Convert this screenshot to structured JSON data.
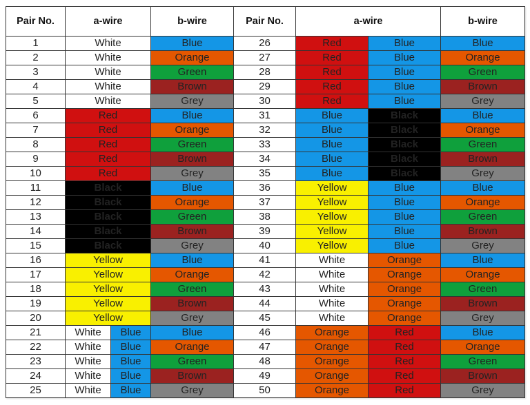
{
  "headers": {
    "pair_no": "Pair No.",
    "a_wire": "a-wire",
    "b_wire": "b-wire"
  },
  "colors": {
    "White": "#ffffff",
    "Blue": "#1496e6",
    "Orange": "#e55700",
    "Green": "#0fa03c",
    "Brown": "#9b2220",
    "Grey": "#828282",
    "Red": "#d01010",
    "Black": "#000000",
    "Yellow": "#f9f000"
  },
  "pairs": [
    {
      "pair": "1",
      "a": [
        "White"
      ],
      "b": "Blue"
    },
    {
      "pair": "2",
      "a": [
        "White"
      ],
      "b": "Orange"
    },
    {
      "pair": "3",
      "a": [
        "White"
      ],
      "b": "Green"
    },
    {
      "pair": "4",
      "a": [
        "White"
      ],
      "b": "Brown"
    },
    {
      "pair": "5",
      "a": [
        "White"
      ],
      "b": "Grey"
    },
    {
      "pair": "6",
      "a": [
        "Red"
      ],
      "b": "Blue"
    },
    {
      "pair": "7",
      "a": [
        "Red"
      ],
      "b": "Orange"
    },
    {
      "pair": "8",
      "a": [
        "Red"
      ],
      "b": "Green"
    },
    {
      "pair": "9",
      "a": [
        "Red"
      ],
      "b": "Brown"
    },
    {
      "pair": "10",
      "a": [
        "Red"
      ],
      "b": "Grey"
    },
    {
      "pair": "11",
      "a": [
        "Black"
      ],
      "b": "Blue"
    },
    {
      "pair": "12",
      "a": [
        "Black"
      ],
      "b": "Orange"
    },
    {
      "pair": "13",
      "a": [
        "Black"
      ],
      "b": "Green"
    },
    {
      "pair": "14",
      "a": [
        "Black"
      ],
      "b": "Brown"
    },
    {
      "pair": "15",
      "a": [
        "Black"
      ],
      "b": "Grey"
    },
    {
      "pair": "16",
      "a": [
        "Yellow"
      ],
      "b": "Blue"
    },
    {
      "pair": "17",
      "a": [
        "Yellow"
      ],
      "b": "Orange"
    },
    {
      "pair": "18",
      "a": [
        "Yellow"
      ],
      "b": "Green"
    },
    {
      "pair": "19",
      "a": [
        "Yellow"
      ],
      "b": "Brown"
    },
    {
      "pair": "20",
      "a": [
        "Yellow"
      ],
      "b": "Grey"
    },
    {
      "pair": "21",
      "a": [
        "White",
        "Blue"
      ],
      "b": "Blue"
    },
    {
      "pair": "22",
      "a": [
        "White",
        "Blue"
      ],
      "b": "Orange"
    },
    {
      "pair": "23",
      "a": [
        "White",
        "Blue"
      ],
      "b": "Green"
    },
    {
      "pair": "24",
      "a": [
        "White",
        "Blue"
      ],
      "b": "Brown"
    },
    {
      "pair": "25",
      "a": [
        "White",
        "Blue"
      ],
      "b": "Grey"
    },
    {
      "pair": "26",
      "a": [
        "Red",
        "Blue"
      ],
      "b": "Blue"
    },
    {
      "pair": "27",
      "a": [
        "Red",
        "Blue"
      ],
      "b": "Orange"
    },
    {
      "pair": "28",
      "a": [
        "Red",
        "Blue"
      ],
      "b": "Green"
    },
    {
      "pair": "29",
      "a": [
        "Red",
        "Blue"
      ],
      "b": "Brown"
    },
    {
      "pair": "30",
      "a": [
        "Red",
        "Blue"
      ],
      "b": "Grey"
    },
    {
      "pair": "31",
      "a": [
        "Blue",
        "Black"
      ],
      "b": "Blue"
    },
    {
      "pair": "32",
      "a": [
        "Blue",
        "Black"
      ],
      "b": "Orange"
    },
    {
      "pair": "33",
      "a": [
        "Blue",
        "Black"
      ],
      "b": "Green"
    },
    {
      "pair": "34",
      "a": [
        "Blue",
        "Black"
      ],
      "b": "Brown"
    },
    {
      "pair": "35",
      "a": [
        "Blue",
        "Black"
      ],
      "b": "Grey"
    },
    {
      "pair": "36",
      "a": [
        "Yellow",
        "Blue"
      ],
      "b": "Blue"
    },
    {
      "pair": "37",
      "a": [
        "Yellow",
        "Blue"
      ],
      "b": "Orange"
    },
    {
      "pair": "38",
      "a": [
        "Yellow",
        "Blue"
      ],
      "b": "Green"
    },
    {
      "pair": "39",
      "a": [
        "Yellow",
        "Blue"
      ],
      "b": "Brown"
    },
    {
      "pair": "40",
      "a": [
        "Yellow",
        "Blue"
      ],
      "b": "Grey"
    },
    {
      "pair": "41",
      "a": [
        "White",
        "Orange"
      ],
      "b": "Blue"
    },
    {
      "pair": "42",
      "a": [
        "White",
        "Orange"
      ],
      "b": "Orange"
    },
    {
      "pair": "43",
      "a": [
        "White",
        "Orange"
      ],
      "b": "Green"
    },
    {
      "pair": "44",
      "a": [
        "White",
        "Orange"
      ],
      "b": "Brown"
    },
    {
      "pair": "45",
      "a": [
        "White",
        "Orange"
      ],
      "b": "Grey"
    },
    {
      "pair": "46",
      "a": [
        "Orange",
        "Red"
      ],
      "b": "Blue"
    },
    {
      "pair": "47",
      "a": [
        "Orange",
        "Red"
      ],
      "b": "Orange"
    },
    {
      "pair": "48",
      "a": [
        "Orange",
        "Red"
      ],
      "b": "Green"
    },
    {
      "pair": "49",
      "a": [
        "Orange",
        "Red"
      ],
      "b": "Brown"
    },
    {
      "pair": "50",
      "a": [
        "Orange",
        "Red"
      ],
      "b": "Grey"
    }
  ]
}
